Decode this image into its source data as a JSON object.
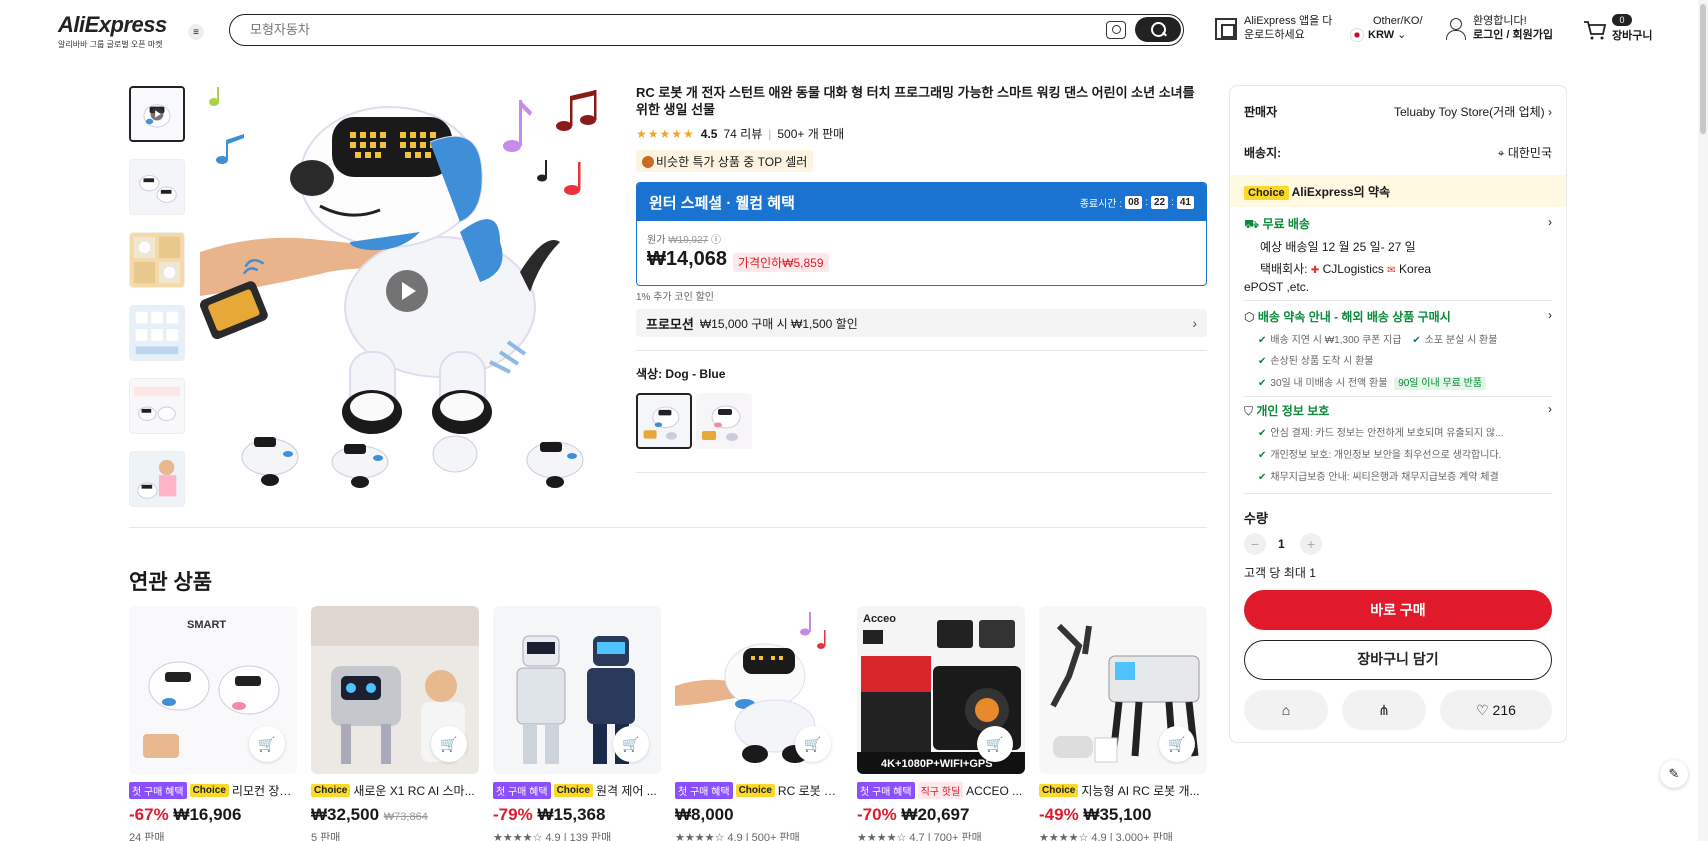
{
  "header": {
    "logo": "AliExpress",
    "logo_sub": "알리바바 그룹 글로벌 오픈 마켓",
    "search_placeholder": "모형자동차",
    "app_line1": "AliExpress 앱을 다",
    "app_line2": "운로드하세요",
    "region_line1": "Other/KO/",
    "region_line2": "KRW",
    "user_line1": "환영합니다!",
    "user_line2": "로그인 / 회원가입",
    "cart_count": "0",
    "cart_label": "장바구니"
  },
  "product": {
    "title": "RC 로봇 개 전자 스턴트 애완 동물 대화 형 터치 프로그래밍 가능한 스마트 워킹 댄스 어린이 소년 소녀를 위한 생일 선물",
    "stars": "★★★★★",
    "rating": "4.5",
    "reviews": "74 리뷰",
    "sold": "500+ 개 판매",
    "top_seller": "비슷한 특가 상품 중 TOP 셀러",
    "winter_title": "윈터 스페셜 · 웰컴 혜택",
    "countdown_label": "종료시간 :",
    "countdown": [
      "08",
      "22",
      "41"
    ],
    "orig_label": "원가",
    "orig_price": "₩19,927",
    "price": "₩14,068",
    "discount": "가격인하₩5,859",
    "coin": "1% 추가 코인 할인",
    "promo_label": "프로모션",
    "promo_text": "₩15,000 구매 시 ₩1,500 할인",
    "color_label": "색상: Dog - Blue"
  },
  "panel": {
    "seller_label": "판매자",
    "seller_name": "Teluaby Toy Store(거래 업체)",
    "ship_label": "배송지:",
    "ship_to": "대한민국",
    "choice_tag": "Choice",
    "promise": "AliExpress의 약속",
    "free_ship": "무료 배송",
    "eta": "예상 배송일 12 월 25 일- 27 일",
    "carrier_label": "택배회사:",
    "carrier1": "CJLogistics",
    "carrier2": "Korea",
    "carrier3": "ePOST ,etc.",
    "guarantee_title": "배송 약속 안내 - 해외 배송 상품 구매시",
    "g1": "배송 지연 시 ₩1,300 쿠폰 지급",
    "g2": "소포 분실 시 환불",
    "g3": "손상된 상품 도착 시 환불",
    "g4": "30일 내 미배송 시 전액 환불",
    "g4_tag": "90일 이내 무료 반품",
    "privacy_title": "개인 정보 보호",
    "p1": "안심 결제: 카드 정보는 안전하게 보호되며 유출되지 않...",
    "p2": "개인정보 보호: 개인정보 보안을 최우선으로 생각합니다.",
    "p3": "채무지급보증 안내: 씨티은행과 채무지급보증 계약 체결",
    "qty_label": "수량",
    "qty": "1",
    "limit": "고객 당 최대 1",
    "buy_now": "바로 구매",
    "add_cart": "장바구니 담기",
    "wish_count": "216"
  },
  "related": {
    "title": "연관 상품",
    "tag_first": "첫 구매 혜택",
    "tag_choice": "Choice",
    "tag_direct": "직구 핫딜",
    "items": [
      {
        "name": "리모컨 장난...",
        "pct": "-67%",
        "price": "₩16,906",
        "orig": "",
        "sold": "24 판매"
      },
      {
        "name": "새로운 X1 RC AI 스마...",
        "pct": "",
        "price": "₩32,500",
        "orig": "₩73,864",
        "sold": "5 판매"
      },
      {
        "name": "원격 제어 ...",
        "pct": "-79%",
        "price": "₩15,368",
        "orig": "",
        "sold": "★★★★☆ 4.9 | 139 판매"
      },
      {
        "name": "RC 로봇 개...",
        "pct": "",
        "price": "₩8,000",
        "orig": "",
        "sold": "★★★★☆ 4.9 | 500+ 판매"
      },
      {
        "name": "ACCEO ...",
        "pct": "-70%",
        "price": "₩20,697",
        "orig": "",
        "sold": "★★★★☆ 4.7 | 700+ 판매"
      },
      {
        "name": "지능형 AI RC 로봇 개...",
        "pct": "-49%",
        "price": "₩35,100",
        "orig": "",
        "sold": "★★★★☆ 4.9 | 3,000+ 판매"
      }
    ]
  }
}
